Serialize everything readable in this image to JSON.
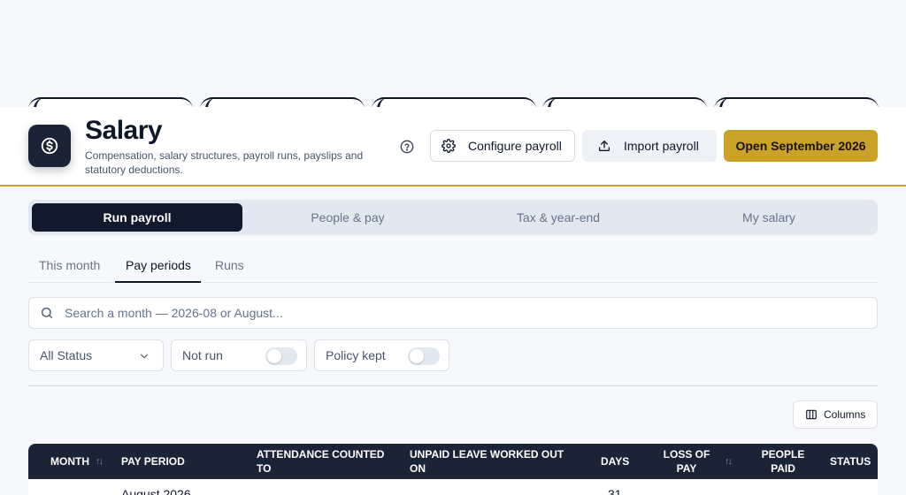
{
  "header": {
    "title": "Salary",
    "subtitle": "Compensation, salary structures, payroll runs, payslips and statutory deductions.",
    "icons": {
      "app": "dollar-circle-icon",
      "help": "question-circle-icon"
    },
    "buttons": {
      "configure": "Configure payroll",
      "import": "Import payroll",
      "open": "Open September 2026"
    }
  },
  "sections": [
    "Run payroll",
    "People & pay",
    "Tax & year-end",
    "My salary"
  ],
  "subtabs": [
    "This month",
    "Pay periods",
    "Runs"
  ],
  "search": {
    "placeholder": "Search a month — 2026-08 or August..."
  },
  "filters": {
    "status": "All Status",
    "not_run": "Not run",
    "policy_kept": "Policy kept"
  },
  "columns_button": "Columns",
  "table": {
    "headers": {
      "month": "MONTH",
      "pay_period": "PAY PERIOD",
      "attendance": "ATTENDANCE COUNTED TO",
      "unpaid_leave": "UNPAID LEAVE WORKED OUT ON",
      "days": "DAYS",
      "loss_of_pay": "LOSS OF PAY",
      "people_paid": "PEOPLE PAID",
      "status": "STATUS"
    },
    "rows": [
      {
        "pay_period": "August 2026",
        "days": "31"
      }
    ]
  },
  "colors": {
    "accent": "#c9a227",
    "navy": "#1b2436",
    "active_segment": "#111a2c"
  }
}
